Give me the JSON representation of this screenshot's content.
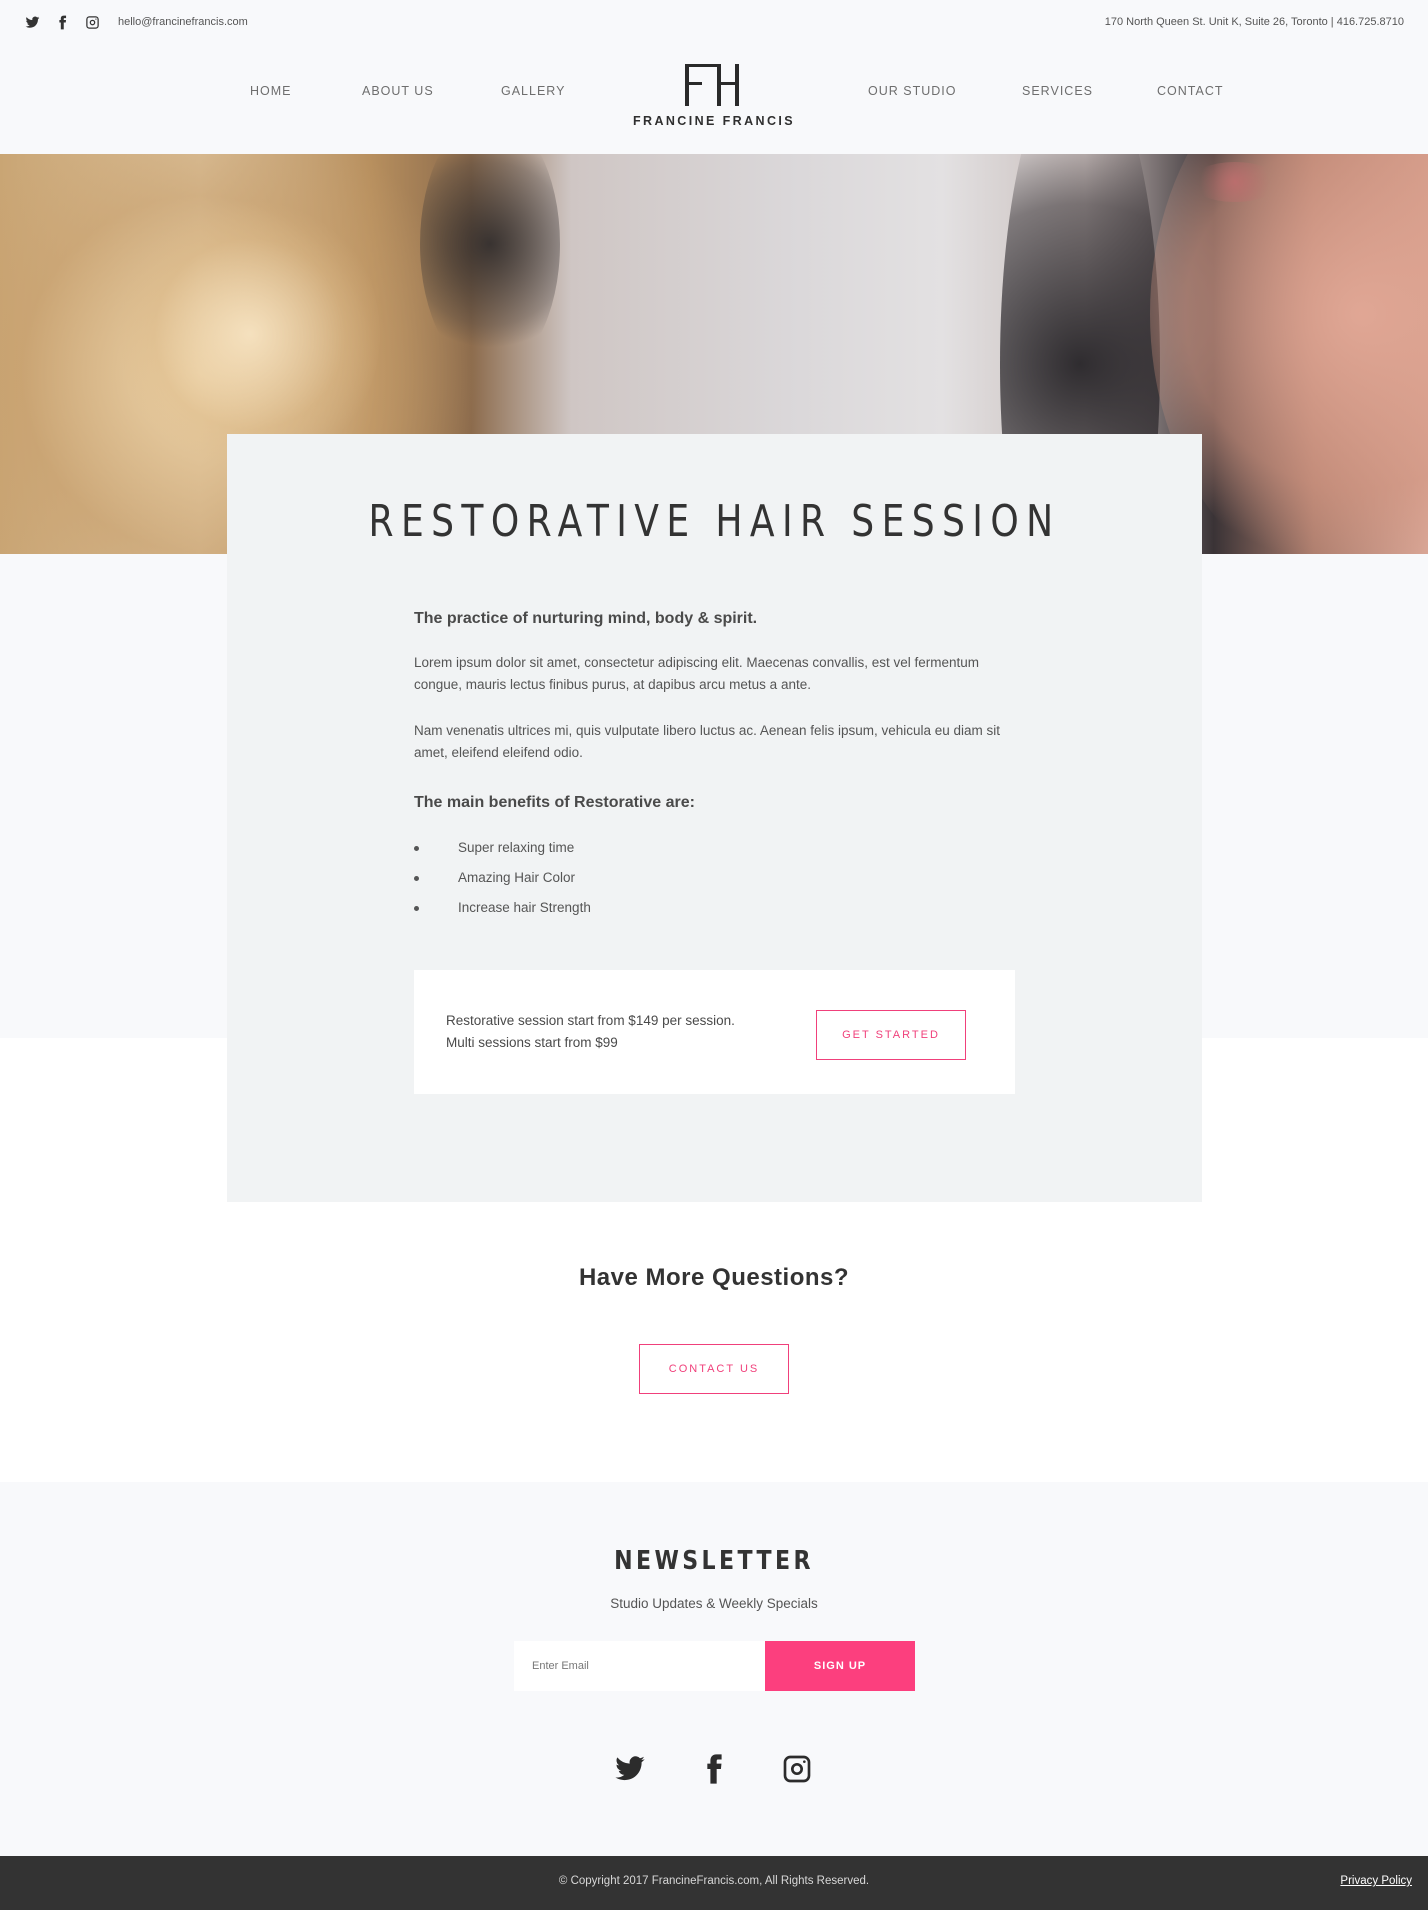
{
  "topbar": {
    "email": "hello@francinefrancis.com",
    "address": "170 North Queen St. Unit K, Suite 26, Toronto | 416.725.8710",
    "social_icons": [
      "twitter-icon",
      "facebook-icon",
      "instagram-icon"
    ]
  },
  "nav": {
    "left_items": [
      "HOME",
      "ABOUT US",
      "GALLERY"
    ],
    "right_items": [
      "OUR STUDIO",
      "SERVICES",
      "CONTACT"
    ],
    "logo_monogram": "FF",
    "logo_text": "FRANCINE FRANCIS"
  },
  "card": {
    "title": "RESTORATIVE HAIR SESSION",
    "subhead": "The practice of nurturing mind, body & spirit.",
    "paragraphs": [
      "Lorem ipsum dolor sit amet, consectetur adipiscing elit. Maecenas convallis, est vel fermentum congue, mauris lectus finibus purus, at dapibus arcu metus a ante.",
      "Nam venenatis ultrices mi, quis vulputate libero luctus ac. Aenean felis ipsum, vehicula eu diam sit amet, eleifend eleifend odio."
    ],
    "benefits_heading": "The main benefits of Restorative are:",
    "benefits": [
      "Super relaxing time",
      "Amazing Hair Color",
      "Increase hair Strength"
    ],
    "price_line1": "Restorative session start from $149 per session.",
    "price_line2": "Multi sessions start from $99",
    "cta_label": "GET STARTED"
  },
  "questions": {
    "title": "Have More Questions?",
    "button_label": "CONTACT US"
  },
  "newsletter": {
    "title": "NEWSLETTER",
    "subtitle": "Studio Updates & Weekly Specials",
    "email_placeholder": "Enter Email",
    "button_label": "SIGN UP"
  },
  "footer": {
    "copyright": "© Copyright 2017 FrancineFrancis.com, All Rights Reserved.",
    "privacy_label": "Privacy Policy"
  },
  "colors": {
    "accent": "#fc3f7e",
    "footer_bg": "#333333",
    "page_bg": "#f8f9fb",
    "card_bg": "#f1f3f4"
  }
}
